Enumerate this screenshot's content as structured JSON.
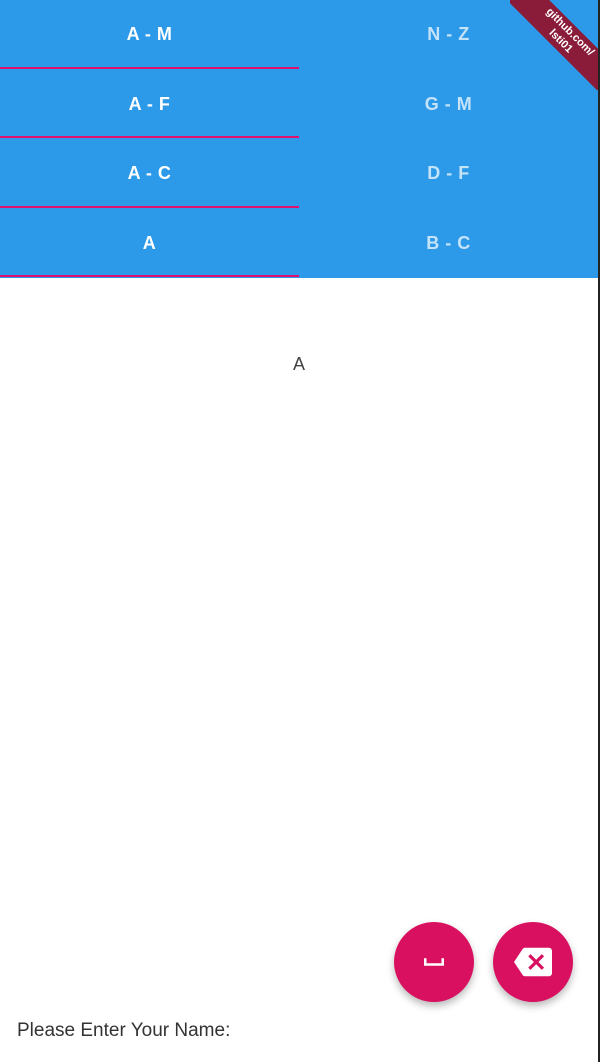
{
  "ribbon": {
    "line1": "github.com/",
    "line2": "lsti01"
  },
  "tab_rows": [
    {
      "left": "A - M",
      "right": "N - Z"
    },
    {
      "left": "A - F",
      "right": "G - M"
    },
    {
      "left": "A - C",
      "right": "D - F"
    },
    {
      "left": "A",
      "right": "B - C"
    }
  ],
  "content": {
    "letter": "A"
  },
  "fabs": {
    "space_icon": "space-bar-icon",
    "backspace_icon": "backspace-icon"
  },
  "footer": {
    "prompt": "Please Enter Your Name:"
  },
  "colors": {
    "tab_bar": "#2d9ae9",
    "indicator": "#e0126e",
    "fab": "#d9105f",
    "ribbon": "#8a1c3a"
  }
}
